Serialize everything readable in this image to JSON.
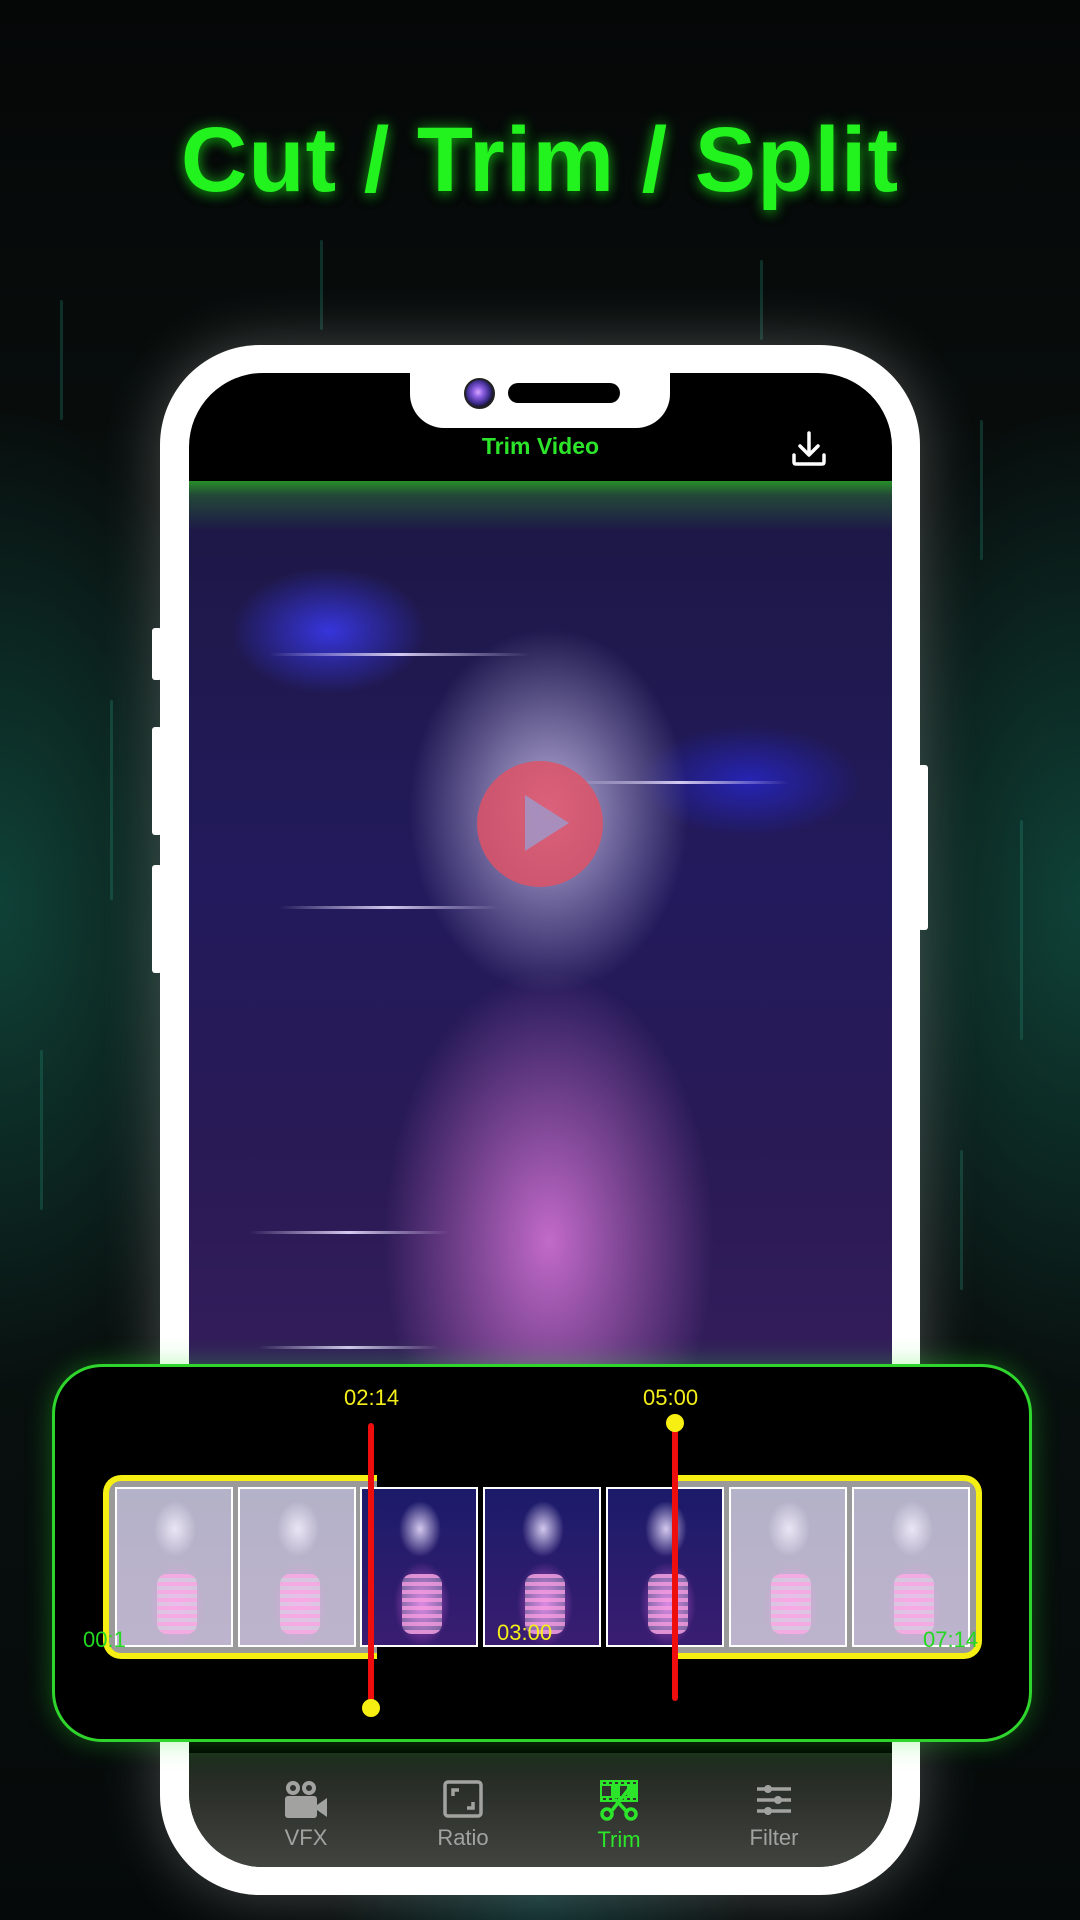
{
  "hero": {
    "title": "Cut / Trim / Split"
  },
  "app_bar": {
    "title": "Trim Video",
    "download_icon": "download-icon"
  },
  "video": {
    "play_icon": "play-icon"
  },
  "timeline": {
    "start_label": "00:1",
    "end_label": "07:14",
    "selection_start": "02:14",
    "selection_end": "05:00",
    "selection_duration": "03:00",
    "thumbnail_count": 7
  },
  "bottom_nav": {
    "items": [
      {
        "label": "VFX",
        "icon": "video-camera-icon",
        "active": false
      },
      {
        "label": "Ratio",
        "icon": "aspect-ratio-icon",
        "active": false
      },
      {
        "label": "Trim",
        "icon": "trim-scissors-icon",
        "active": true
      },
      {
        "label": "Filter",
        "icon": "sliders-icon",
        "active": false
      }
    ]
  },
  "colors": {
    "accent_green": "#2ce52a",
    "title_green": "#22f21e",
    "handle_yellow": "#f5ef14",
    "cut_red": "#ee0e0e",
    "inactive_gray": "#a2a3a0"
  }
}
